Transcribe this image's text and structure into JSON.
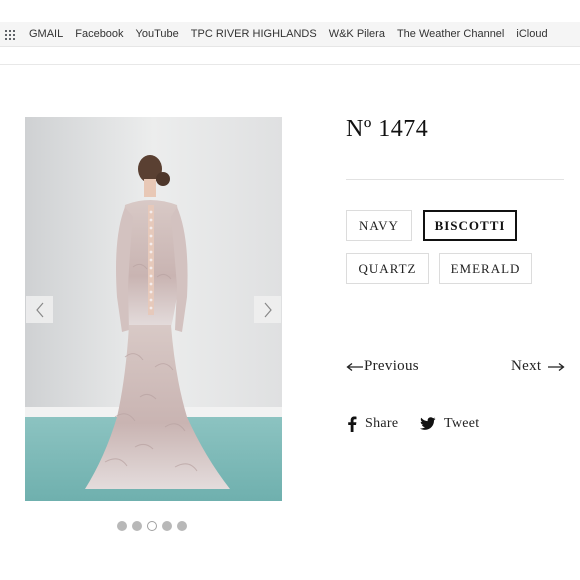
{
  "bookmarks": {
    "items": [
      {
        "label": "GMAIL"
      },
      {
        "label": "Facebook"
      },
      {
        "label": "YouTube"
      },
      {
        "label": "TPC RIVER HIGHLANDS"
      },
      {
        "label": "W&K Pilera"
      },
      {
        "label": "The Weather Channel"
      },
      {
        "label": "iCloud"
      }
    ]
  },
  "product": {
    "title": "Nº 1474",
    "colors": [
      {
        "label": "NAVY",
        "selected": false
      },
      {
        "label": "BISCOTTI",
        "selected": true
      },
      {
        "label": "QUARTZ",
        "selected": false
      },
      {
        "label": "EMERALD",
        "selected": false
      }
    ],
    "nav": {
      "previous": "Previous",
      "next": "Next"
    },
    "share": {
      "facebook": "Share",
      "twitter": "Tweet"
    }
  },
  "carousel": {
    "slide_count": 5,
    "active_index": 2
  },
  "colors": {
    "text": "#111111",
    "border": "#dcdcdc",
    "dot_inactive": "#b8b8b8",
    "floor": "#7fb9b8",
    "wall": "#e6e7e8"
  }
}
